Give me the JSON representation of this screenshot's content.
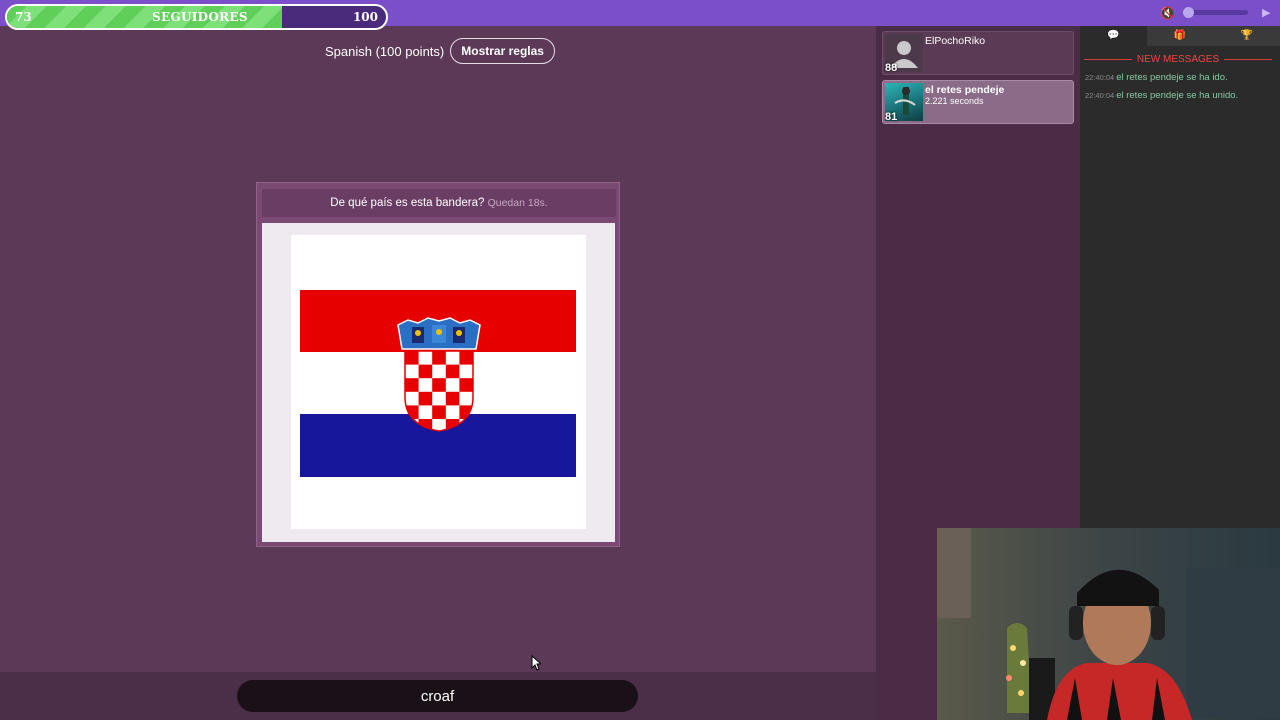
{
  "topbar": {
    "progress_min": "73",
    "progress_label": "SEGUIDORES",
    "progress_max": "100",
    "progress_fraction": 0.73,
    "accent_color": "#7b4fc9"
  },
  "game": {
    "language_label": "Spanish (100 points)",
    "rules_button": "Mostrar reglas",
    "question": "De qué país es esta bandera?",
    "timer": "Quedan 18s.",
    "flag_colors": [
      "#e60000",
      "#ffffff",
      "#17179c"
    ]
  },
  "answer": {
    "value": "croaf"
  },
  "players": [
    {
      "name": "ElPochoRiko",
      "score": "88",
      "time": "",
      "active": false,
      "avatar": "default-user-icon"
    },
    {
      "name": "el retes pendeje",
      "score": "81",
      "time": "2.221 seconds",
      "active": true,
      "avatar": "player-photo"
    }
  ],
  "chat": {
    "tabs": [
      "chat-icon",
      "gift-icon",
      "trophy-icon"
    ],
    "new_messages_label": "NEW MESSAGES",
    "messages": [
      {
        "time": "22:40:04",
        "text": "el retes pendeje se ha ido."
      },
      {
        "time": "22:40:04",
        "text": "el retes pendeje se ha unido."
      }
    ]
  }
}
